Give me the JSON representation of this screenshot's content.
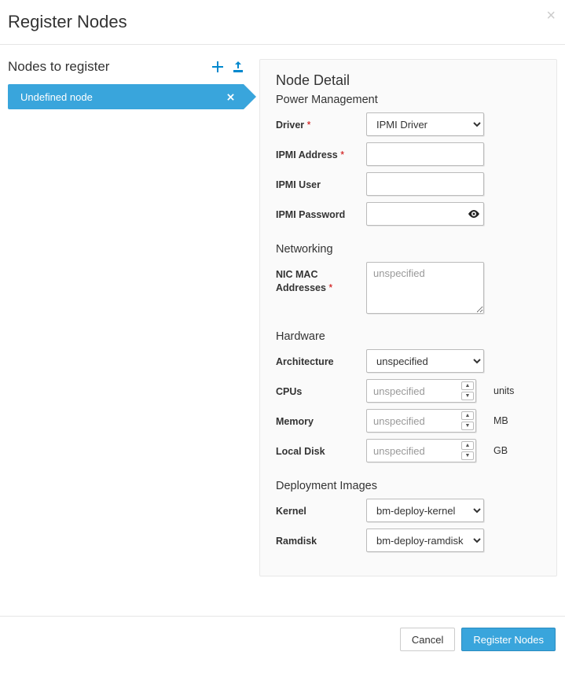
{
  "modal": {
    "title": "Register Nodes"
  },
  "left": {
    "title": "Nodes to register",
    "node_label": "Undefined node"
  },
  "detail": {
    "title": "Node Detail",
    "sections": {
      "power": "Power Management",
      "networking": "Networking",
      "hardware": "Hardware",
      "deployment": "Deployment Images"
    },
    "labels": {
      "driver": "Driver",
      "ipmi_address": "IPMI Address",
      "ipmi_user": "IPMI User",
      "ipmi_password": "IPMI Password",
      "nic_mac": "NIC MAC Addresses",
      "architecture": "Architecture",
      "cpus": "CPUs",
      "memory": "Memory",
      "local_disk": "Local Disk",
      "kernel": "Kernel",
      "ramdisk": "Ramdisk"
    },
    "values": {
      "driver": "IPMI Driver",
      "architecture": "unspecified",
      "kernel": "bm-deploy-kernel",
      "ramdisk": "bm-deploy-ramdisk"
    },
    "placeholders": {
      "nic_mac": "unspecified",
      "cpus": "unspecified",
      "memory": "unspecified",
      "local_disk": "unspecified"
    },
    "suffix": {
      "cpus": "units",
      "memory": "MB",
      "local_disk": "GB"
    }
  },
  "footer": {
    "cancel": "Cancel",
    "submit": "Register Nodes"
  }
}
